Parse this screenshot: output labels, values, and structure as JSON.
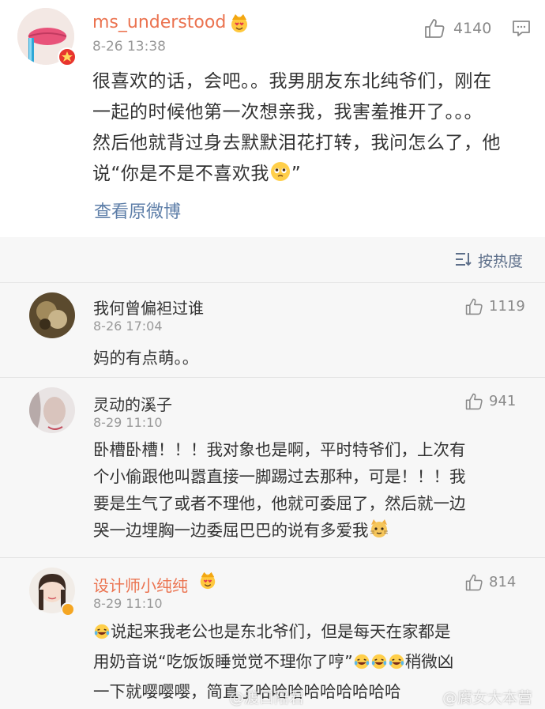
{
  "post": {
    "username": "ms_understood",
    "time": "8-26 13:38",
    "like_count": "4140",
    "body_lines": [
      "很喜欢的话，会吧。。我男朋友东北纯爷们，刚在",
      "一起的时候他第一次想亲我，我害羞推开了。。。",
      "然后他就背过身去默默泪花打转，我问怎么了，他",
      "说“你是不是不喜欢我"
    ],
    "body_tail": "”",
    "view_original": "查看原微博"
  },
  "sort": {
    "label": "按热度"
  },
  "comments": [
    {
      "username": "我何曾偏袒过谁",
      "time": "8-26 17:04",
      "like_count": "1119",
      "lines": [
        "妈的有点萌。。"
      ]
    },
    {
      "username": "灵动的溪子",
      "time": "8-29 11:10",
      "like_count": "941",
      "lines": [
        "卧槽卧槽！！！我对象也是啊，平时特爷们，上次有",
        "个小偷跟他叫嚣直接一脚踢过去那种，可是！！！我",
        "要是生气了或者不理他，他就可委屈了，然后就一边",
        "哭一边埋胸一边委屈巴巴的说有多爱我"
      ]
    },
    {
      "username": "设计师小纯纯",
      "time": "8-29 11:10",
      "like_count": "814",
      "lines": [
        "说起来我老公也是东北爷们，但是每天在家都是",
        "用奶音说“吃饭饭睡觉觉不理你了哼”",
        "一下就嘤嘤嘤，简直了哈哈哈哈哈哈哈哈哈"
      ],
      "line2_tail": "稍微凶"
    }
  ],
  "watermarks": [
    "@渡口陪君",
    "@腐女大本营"
  ],
  "colors": {
    "username_accent": "#eb7350",
    "link": "#5d7ea8",
    "meta": "#999999",
    "background": "#f7f7f7"
  },
  "icons": [
    "crown-emoji-icon",
    "thumbs-up-icon",
    "comment-icon",
    "sort-icon",
    "pleading-face-icon",
    "cat-face-icon",
    "laughing-crying-icon",
    "vip-badge-icon"
  ]
}
